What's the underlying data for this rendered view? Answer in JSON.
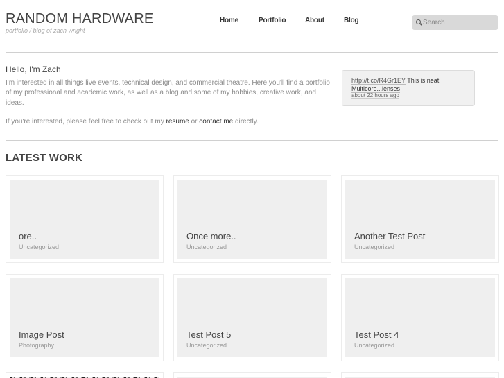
{
  "site": {
    "title": "RANDOM HARDWARE",
    "tagline": "portfolio / blog of zach wright"
  },
  "nav": {
    "items": [
      {
        "label": "Home"
      },
      {
        "label": "Portfolio"
      },
      {
        "label": "About"
      },
      {
        "label": "Blog"
      }
    ]
  },
  "search": {
    "placeholder": "Search",
    "icon": "search-icon"
  },
  "intro": {
    "hello": "Hello, I'm Zach",
    "body": "I'm interested in all things live events, technical design, and commercial theatre. Here you'll find a portfolio of my professional and academic work, as well as a blog and some of my hobbies, creative work, and ideas.",
    "cta_prefix": "If you're interested, please feel free to check out my ",
    "resume_label": "resume",
    "cta_middle": " or ",
    "contact_label": "contact me",
    "cta_suffix": " directly."
  },
  "tweet": {
    "link": "http://t.co/R4Gr1EY",
    "text": " This is neat. ",
    "text_link": "Multicore...lenses",
    "time": "about 22 hours ago"
  },
  "latest": {
    "heading": "LATEST WORK",
    "posts": [
      {
        "title": "ore..",
        "category": "Uncategorized"
      },
      {
        "title": "Once more..",
        "category": "Uncategorized"
      },
      {
        "title": "Another Test Post",
        "category": "Uncategorized"
      },
      {
        "title": "Image Post",
        "category": "Photography"
      },
      {
        "title": "Test Post 5",
        "category": "Uncategorized"
      },
      {
        "title": "Test Post 4",
        "category": "Uncategorized"
      }
    ]
  }
}
